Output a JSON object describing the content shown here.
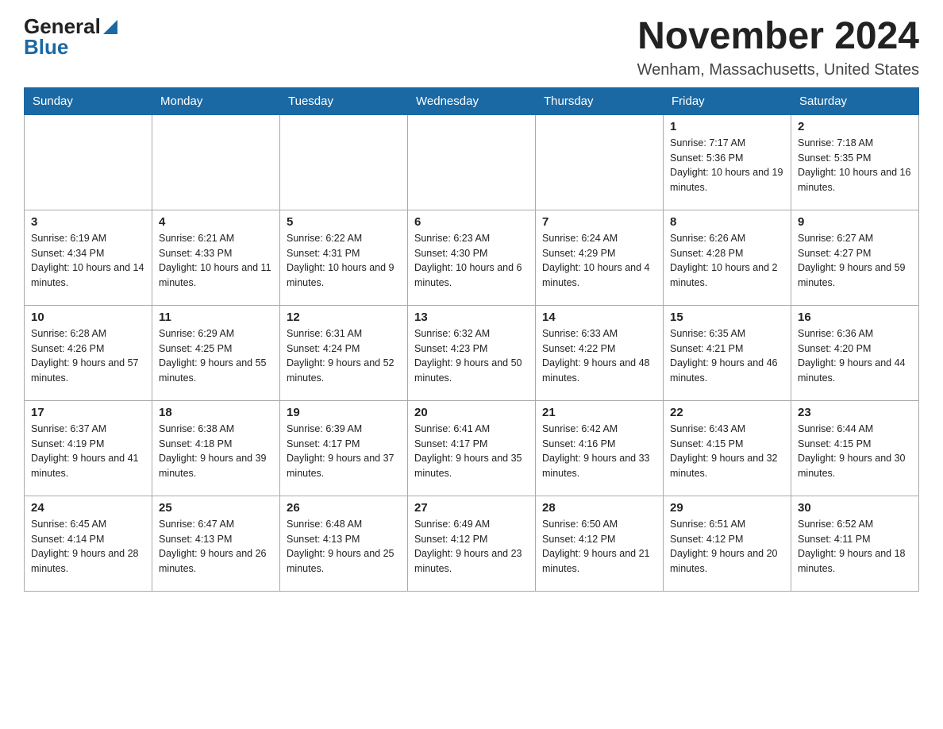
{
  "header": {
    "logo_general": "General",
    "logo_blue": "Blue",
    "title": "November 2024",
    "subtitle": "Wenham, Massachusetts, United States"
  },
  "weekdays": [
    "Sunday",
    "Monday",
    "Tuesday",
    "Wednesday",
    "Thursday",
    "Friday",
    "Saturday"
  ],
  "weeks": [
    [
      {
        "day": "",
        "info": ""
      },
      {
        "day": "",
        "info": ""
      },
      {
        "day": "",
        "info": ""
      },
      {
        "day": "",
        "info": ""
      },
      {
        "day": "",
        "info": ""
      },
      {
        "day": "1",
        "info": "Sunrise: 7:17 AM\nSunset: 5:36 PM\nDaylight: 10 hours and 19 minutes."
      },
      {
        "day": "2",
        "info": "Sunrise: 7:18 AM\nSunset: 5:35 PM\nDaylight: 10 hours and 16 minutes."
      }
    ],
    [
      {
        "day": "3",
        "info": "Sunrise: 6:19 AM\nSunset: 4:34 PM\nDaylight: 10 hours and 14 minutes."
      },
      {
        "day": "4",
        "info": "Sunrise: 6:21 AM\nSunset: 4:33 PM\nDaylight: 10 hours and 11 minutes."
      },
      {
        "day": "5",
        "info": "Sunrise: 6:22 AM\nSunset: 4:31 PM\nDaylight: 10 hours and 9 minutes."
      },
      {
        "day": "6",
        "info": "Sunrise: 6:23 AM\nSunset: 4:30 PM\nDaylight: 10 hours and 6 minutes."
      },
      {
        "day": "7",
        "info": "Sunrise: 6:24 AM\nSunset: 4:29 PM\nDaylight: 10 hours and 4 minutes."
      },
      {
        "day": "8",
        "info": "Sunrise: 6:26 AM\nSunset: 4:28 PM\nDaylight: 10 hours and 2 minutes."
      },
      {
        "day": "9",
        "info": "Sunrise: 6:27 AM\nSunset: 4:27 PM\nDaylight: 9 hours and 59 minutes."
      }
    ],
    [
      {
        "day": "10",
        "info": "Sunrise: 6:28 AM\nSunset: 4:26 PM\nDaylight: 9 hours and 57 minutes."
      },
      {
        "day": "11",
        "info": "Sunrise: 6:29 AM\nSunset: 4:25 PM\nDaylight: 9 hours and 55 minutes."
      },
      {
        "day": "12",
        "info": "Sunrise: 6:31 AM\nSunset: 4:24 PM\nDaylight: 9 hours and 52 minutes."
      },
      {
        "day": "13",
        "info": "Sunrise: 6:32 AM\nSunset: 4:23 PM\nDaylight: 9 hours and 50 minutes."
      },
      {
        "day": "14",
        "info": "Sunrise: 6:33 AM\nSunset: 4:22 PM\nDaylight: 9 hours and 48 minutes."
      },
      {
        "day": "15",
        "info": "Sunrise: 6:35 AM\nSunset: 4:21 PM\nDaylight: 9 hours and 46 minutes."
      },
      {
        "day": "16",
        "info": "Sunrise: 6:36 AM\nSunset: 4:20 PM\nDaylight: 9 hours and 44 minutes."
      }
    ],
    [
      {
        "day": "17",
        "info": "Sunrise: 6:37 AM\nSunset: 4:19 PM\nDaylight: 9 hours and 41 minutes."
      },
      {
        "day": "18",
        "info": "Sunrise: 6:38 AM\nSunset: 4:18 PM\nDaylight: 9 hours and 39 minutes."
      },
      {
        "day": "19",
        "info": "Sunrise: 6:39 AM\nSunset: 4:17 PM\nDaylight: 9 hours and 37 minutes."
      },
      {
        "day": "20",
        "info": "Sunrise: 6:41 AM\nSunset: 4:17 PM\nDaylight: 9 hours and 35 minutes."
      },
      {
        "day": "21",
        "info": "Sunrise: 6:42 AM\nSunset: 4:16 PM\nDaylight: 9 hours and 33 minutes."
      },
      {
        "day": "22",
        "info": "Sunrise: 6:43 AM\nSunset: 4:15 PM\nDaylight: 9 hours and 32 minutes."
      },
      {
        "day": "23",
        "info": "Sunrise: 6:44 AM\nSunset: 4:15 PM\nDaylight: 9 hours and 30 minutes."
      }
    ],
    [
      {
        "day": "24",
        "info": "Sunrise: 6:45 AM\nSunset: 4:14 PM\nDaylight: 9 hours and 28 minutes."
      },
      {
        "day": "25",
        "info": "Sunrise: 6:47 AM\nSunset: 4:13 PM\nDaylight: 9 hours and 26 minutes."
      },
      {
        "day": "26",
        "info": "Sunrise: 6:48 AM\nSunset: 4:13 PM\nDaylight: 9 hours and 25 minutes."
      },
      {
        "day": "27",
        "info": "Sunrise: 6:49 AM\nSunset: 4:12 PM\nDaylight: 9 hours and 23 minutes."
      },
      {
        "day": "28",
        "info": "Sunrise: 6:50 AM\nSunset: 4:12 PM\nDaylight: 9 hours and 21 minutes."
      },
      {
        "day": "29",
        "info": "Sunrise: 6:51 AM\nSunset: 4:12 PM\nDaylight: 9 hours and 20 minutes."
      },
      {
        "day": "30",
        "info": "Sunrise: 6:52 AM\nSunset: 4:11 PM\nDaylight: 9 hours and 18 minutes."
      }
    ]
  ]
}
